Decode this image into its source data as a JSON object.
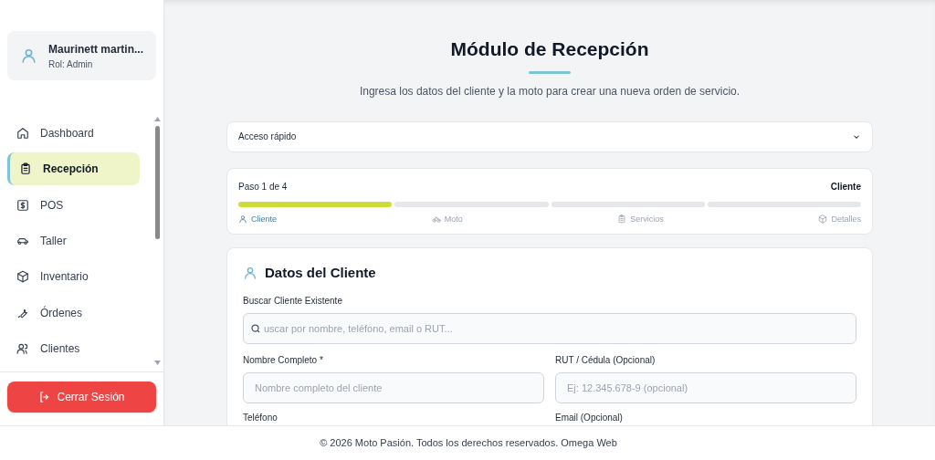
{
  "user": {
    "name": "Maurinett martin...",
    "role": "Rol: Admin"
  },
  "nav": [
    {
      "label": "Dashboard",
      "selected": false
    },
    {
      "label": "Recepción",
      "selected": true
    },
    {
      "label": "POS",
      "selected": false
    },
    {
      "label": "Taller",
      "selected": false
    },
    {
      "label": "Inventario",
      "selected": false
    },
    {
      "label": "Órdenes",
      "selected": false
    },
    {
      "label": "Clientes",
      "selected": false
    }
  ],
  "logout": "Cerrar Sesión",
  "header": {
    "title": "Módulo de Recepción",
    "subtitle": "Ingresa los datos del cliente y la moto para crear una nueva orden de servicio."
  },
  "quick_access": {
    "label": "Acceso rápido",
    "expanded": false
  },
  "progress": {
    "step_text": "Paso 1 de 4",
    "current": "Cliente",
    "steps": [
      {
        "label": "Cliente",
        "selected": true
      },
      {
        "label": "Moto",
        "selected": false
      },
      {
        "label": "Servicios",
        "selected": false
      },
      {
        "label": "Detalles",
        "selected": false
      }
    ]
  },
  "form": {
    "title": "Datos del Cliente",
    "search_label": "Buscar Cliente Existente",
    "search_placeholder": "uscar por nombre, teléfono, email o RUT...",
    "fields": [
      {
        "label": "Nombre Completo *",
        "placeholder": "Nombre completo del cliente"
      },
      {
        "label": "RUT / Cédula (Opcional)",
        "placeholder": "Ej: 12.345.678-9 (opcional)"
      },
      {
        "label": "Teléfono"
      },
      {
        "label": "Email (Opcional)"
      }
    ]
  },
  "footer": "© 2026 Moto Pasión. Todos los derechos reservados. Omega Web"
}
